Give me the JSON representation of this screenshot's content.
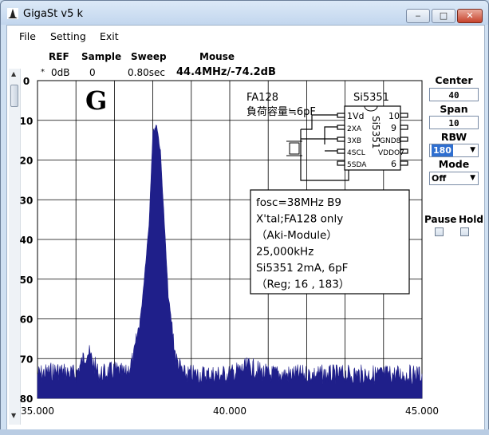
{
  "window": {
    "title": "GigaSt v5 k",
    "buttons": {
      "minimize": "‒",
      "maximize": "□",
      "close": "✕"
    }
  },
  "menu": [
    "File",
    "Setting",
    "Exit"
  ],
  "header": {
    "labels": {
      "ref": "REF",
      "sample": "Sample",
      "sweep": "Sweep",
      "mouse": "Mouse"
    },
    "values": {
      "marker": "*",
      "ref": "0dB",
      "sample": "0",
      "sweep": "0.80sec",
      "mouse": "44.4MHz/-74.2dB"
    }
  },
  "plot": {
    "y_ticks": [
      "0",
      "10",
      "20",
      "30",
      "40",
      "50",
      "60",
      "70",
      "80"
    ],
    "x_ticks": [
      "35.000",
      "40.000",
      "45.000"
    ],
    "big_letter": "G",
    "trace_color": "#1f1f8a"
  },
  "chart_data": {
    "type": "area",
    "xlim": [
      35.0,
      45.0
    ],
    "ylim": [
      80,
      0
    ],
    "grid": true,
    "x_unit": "MHz",
    "y_unit": "dB below REF",
    "series": [
      {
        "x": [
          35.0,
          35.5,
          36.0,
          36.3,
          36.6,
          37.0,
          37.3,
          37.5,
          37.7,
          37.9,
          38.0,
          38.1,
          38.2,
          38.3,
          38.4,
          38.6,
          38.8,
          39.0,
          39.5,
          40.0,
          40.5,
          41.0,
          41.5,
          42.0,
          42.5,
          43.0,
          43.5,
          44.0,
          44.4,
          45.0
        ],
        "y": [
          74,
          73,
          74,
          68,
          74,
          73,
          74,
          70,
          58,
          36,
          13,
          11,
          18,
          36,
          54,
          70,
          74,
          74,
          74,
          74,
          72,
          74,
          74,
          74,
          74,
          74,
          74,
          74,
          74,
          74
        ]
      }
    ]
  },
  "annotations": {
    "chip_part": "FA128",
    "chip_note": "負荷容量≒6pF",
    "ic_name": "Si5351",
    "pins_left": [
      "1Vd",
      "2XA",
      "3XB",
      "4SCL",
      "5SDA"
    ],
    "pins_right": [
      "10",
      "9",
      "GND8",
      "VDDO7",
      "6"
    ],
    "ic_body_text": "Si5351",
    "note_lines": [
      "fosc=38MHz B9",
      "X'tal;FA128 only",
      "（Aki-Module）",
      "25,000kHz",
      "Si5351 2mA, 6pF",
      "（Reg;  16 , 183）"
    ]
  },
  "controls": {
    "center": {
      "label": "Center",
      "value": "40"
    },
    "span": {
      "label": "Span",
      "value": "10"
    },
    "rbw": {
      "label": "RBW",
      "value": "180"
    },
    "mode": {
      "label": "Mode",
      "value": "Off"
    },
    "pause": {
      "label": "Pause",
      "checked": false
    },
    "hold": {
      "label": "Hold",
      "checked": false
    }
  }
}
